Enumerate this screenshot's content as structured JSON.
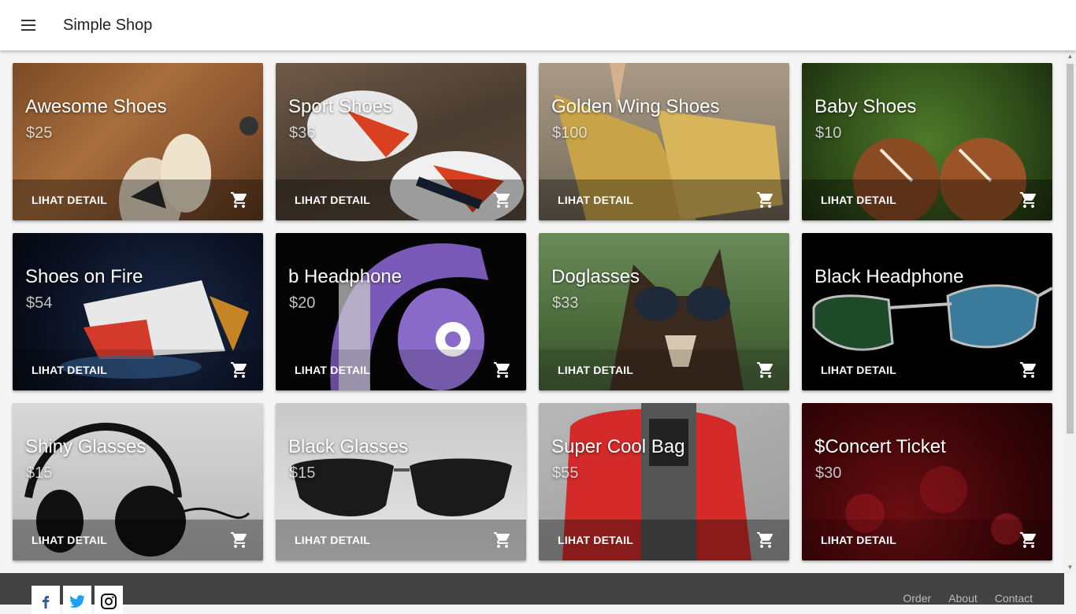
{
  "app": {
    "title": "Simple Shop"
  },
  "products": [
    {
      "name": "Awesome Shoes",
      "price": "$25",
      "detail_label": "LIHAT DETAIL"
    },
    {
      "name": "Sport Shoes",
      "price": "$36",
      "detail_label": "LIHAT DETAIL"
    },
    {
      "name": "Golden Wing Shoes",
      "price": "$100",
      "detail_label": "LIHAT DETAIL"
    },
    {
      "name": "Baby Shoes",
      "price": "$10",
      "detail_label": "LIHAT DETAIL"
    },
    {
      "name": "Shoes on Fire",
      "price": "$54",
      "detail_label": "LIHAT DETAIL"
    },
    {
      "name": "b Headphone",
      "price": "$20",
      "detail_label": "LIHAT DETAIL"
    },
    {
      "name": "Doglasses",
      "price": "$33",
      "detail_label": "LIHAT DETAIL"
    },
    {
      "name": "Black Headphone",
      "price": "",
      "detail_label": "LIHAT DETAIL"
    },
    {
      "name": "Shiny Glasses",
      "price": "$15",
      "detail_label": "LIHAT DETAIL"
    },
    {
      "name": "Black Glasses",
      "price": "$15",
      "detail_label": "LIHAT DETAIL"
    },
    {
      "name": "Super Cool Bag",
      "price": "$55",
      "detail_label": "LIHAT DETAIL"
    },
    {
      "name": "$Concert Ticket",
      "price": "$30",
      "detail_label": "LIHAT DETAIL"
    }
  ],
  "footer": {
    "links": [
      "Order",
      "About",
      "Contact"
    ],
    "social_icons": [
      "facebook-icon",
      "twitter-icon",
      "instagram-icon"
    ]
  },
  "colors": {
    "footer_bg": "#424242",
    "card_bar": "rgba(0,0,0,0.35)"
  }
}
